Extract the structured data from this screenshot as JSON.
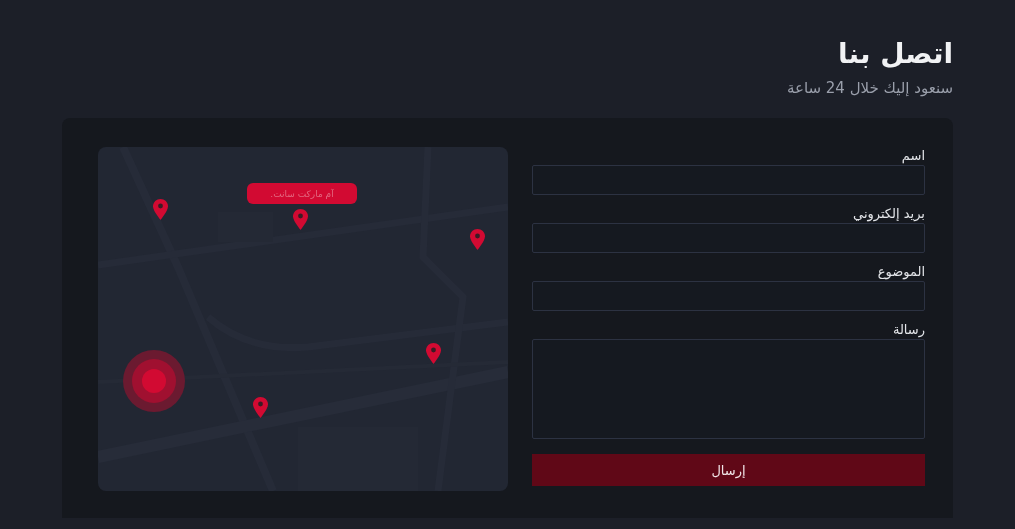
{
  "header": {
    "title": "اتصل بنا",
    "subtitle": "سنعود إليك خلال 24 ساعة"
  },
  "form": {
    "fields": [
      {
        "label": "اسم",
        "kind": "input"
      },
      {
        "label": "بريد إلكتروني",
        "kind": "input"
      },
      {
        "label": "الموضوع",
        "kind": "input"
      },
      {
        "label": "رسالة",
        "kind": "textarea"
      }
    ],
    "submit": "إرسال"
  },
  "map": {
    "kind": "picture",
    "badge": "آم ماركت سانت."
  }
}
